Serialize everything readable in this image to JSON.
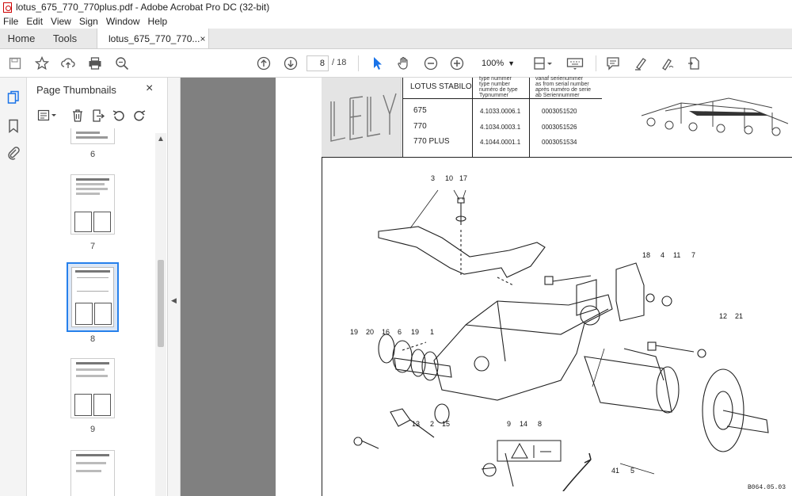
{
  "window": {
    "title": "lotus_675_770_770plus.pdf - Adobe Acrobat Pro DC (32-bit)"
  },
  "menu": [
    "File",
    "Edit",
    "View",
    "Sign",
    "Window",
    "Help"
  ],
  "tabs": {
    "home": "Home",
    "tools": "Tools",
    "document": "lotus_675_770_770...",
    "close": "×"
  },
  "toolbar": {
    "page_current": "8",
    "page_total": "/ 18",
    "zoom": "100%"
  },
  "panel": {
    "title": "Page Thumbnails",
    "close": "×",
    "thumb_labels": [
      "6",
      "7",
      "8",
      "9"
    ]
  },
  "document": {
    "header": {
      "product": "LOTUS STABILO",
      "type_caption": "type nummer\ntype number\nnuméro de type\nTypnummer",
      "serial_caption": "vanaf serienummer\nas from serial number\naprès numéro de serie\nab Seriennummer",
      "rows": [
        {
          "model": "675",
          "type_no": "4.1033.0006.1",
          "serial_no": "0003051520"
        },
        {
          "model": "770",
          "type_no": "4.1034.0003.1",
          "serial_no": "0003051526"
        },
        {
          "model": "770 PLUS",
          "type_no": "4.1044.0001.1",
          "serial_no": "0003051534"
        }
      ]
    },
    "callouts_top": [
      "3",
      "10",
      "17"
    ],
    "callouts_right": [
      "18",
      "11",
      "7",
      "4",
      "12",
      "21"
    ],
    "callouts_left_row": [
      "19",
      "20",
      "16",
      "6",
      "19",
      "1"
    ],
    "callouts_bottom": [
      "13",
      "2",
      "15",
      "9",
      "14",
      "8",
      "41",
      "5"
    ],
    "drawing_code": "B064.05.03"
  }
}
